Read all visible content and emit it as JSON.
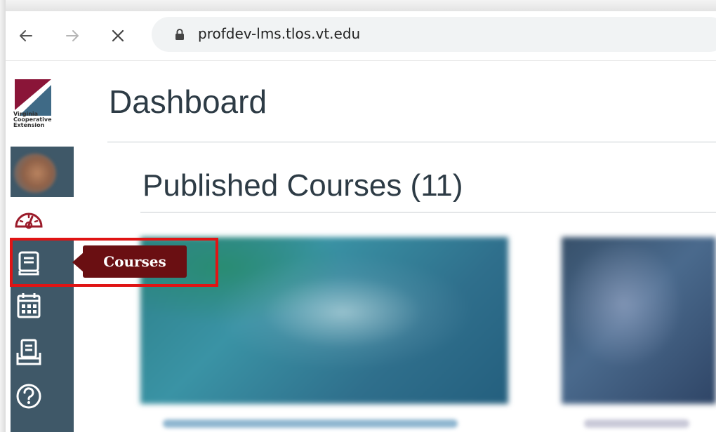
{
  "browser": {
    "back_icon": "arrow-left",
    "forward_icon": "arrow-right",
    "stop_icon": "close",
    "url": "profdev-lms.tlos.vt.edu"
  },
  "global_nav": {
    "logo_text": "Virginia\nCooperative\nExtension",
    "items": [
      {
        "icon": "account-avatar"
      },
      {
        "icon": "dashboard-icon",
        "active": true
      },
      {
        "icon": "courses-icon"
      },
      {
        "icon": "calendar-icon"
      },
      {
        "icon": "inbox-icon"
      },
      {
        "icon": "help-icon"
      }
    ]
  },
  "tooltip": {
    "label": "Courses"
  },
  "main": {
    "title": "Dashboard",
    "section_title": "Published Courses (11)"
  },
  "colors": {
    "nav_bg": "#3f5868",
    "tooltip_bg": "#6a0f12",
    "highlight": "#e01414",
    "dashboard_icon": "#9b1b2a"
  }
}
